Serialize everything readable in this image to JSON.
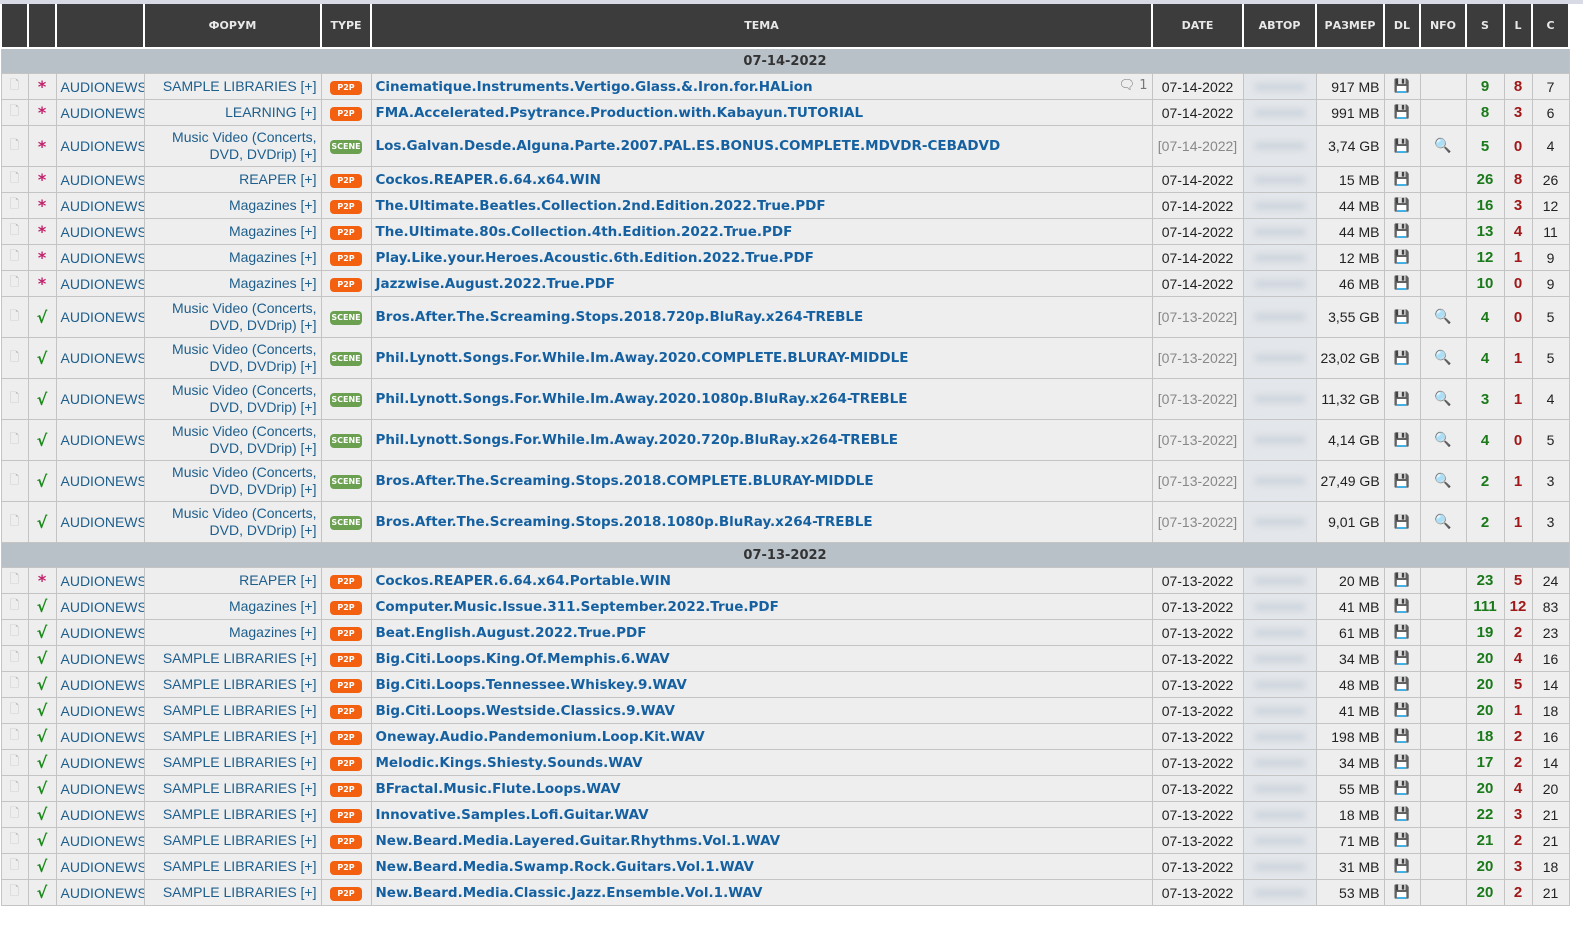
{
  "headers": [
    "",
    "",
    "",
    "ФОРУМ",
    "TYPE",
    "TEMA",
    "DATE",
    "АВТОР",
    "РАЗМЕР",
    "DL",
    "NFO",
    "S",
    "L",
    "C"
  ],
  "groups": [
    {
      "date": "07-14-2022",
      "rows": [
        {
          "st": "*",
          "cat": "AUDIONEWS",
          "forum": "SAMPLE LIBRARIES [+]",
          "type": "P2P",
          "title": "Cinematique.Instruments.Vertigo.Glass.&.Iron.for.HALion",
          "comments": "1",
          "date": "07-14-2022",
          "size": "917 MB",
          "nfo": false,
          "s": "9",
          "l": "8",
          "c": "7"
        },
        {
          "st": "*",
          "cat": "AUDIONEWS",
          "forum": "LEARNING [+]",
          "type": "P2P",
          "title": "FMA.Accelerated.Psytrance.Production.with.Kabayun.TUTORIAL",
          "date": "07-14-2022",
          "size": "991 MB",
          "nfo": false,
          "s": "8",
          "l": "3",
          "c": "6"
        },
        {
          "st": "*",
          "cat": "AUDIONEWS",
          "forum": "Music Video (Concerts, DVD, DVDrip) [+]",
          "type": "SCENE",
          "title": "Los.Galvan.Desde.Alguna.Parte.2007.PAL.ES.BONUS.COMPLETE.MDVDR-CEBADVD",
          "date": "[07-14-2022]",
          "size": "3,74 GB",
          "nfo": true,
          "s": "5",
          "l": "0",
          "c": "4"
        },
        {
          "st": "*",
          "cat": "AUDIONEWS",
          "forum": "REAPER [+]",
          "type": "P2P",
          "title": "Cockos.REAPER.6.64.x64.WIN",
          "date": "07-14-2022",
          "size": "15 MB",
          "nfo": false,
          "s": "26",
          "l": "8",
          "c": "26"
        },
        {
          "st": "*",
          "cat": "AUDIONEWS",
          "forum": "Magazines [+]",
          "type": "P2P",
          "title": "The.Ultimate.Beatles.Collection.2nd.Edition.2022.True.PDF",
          "date": "07-14-2022",
          "size": "44 MB",
          "nfo": false,
          "s": "16",
          "l": "3",
          "c": "12"
        },
        {
          "st": "*",
          "cat": "AUDIONEWS",
          "forum": "Magazines [+]",
          "type": "P2P",
          "title": "The.Ultimate.80s.Collection.4th.Edition.2022.True.PDF",
          "date": "07-14-2022",
          "size": "44 MB",
          "nfo": false,
          "s": "13",
          "l": "4",
          "c": "11"
        },
        {
          "st": "*",
          "cat": "AUDIONEWS",
          "forum": "Magazines [+]",
          "type": "P2P",
          "title": "Play.Like.your.Heroes.Acoustic.6th.Edition.2022.True.PDF",
          "date": "07-14-2022",
          "size": "12 MB",
          "nfo": false,
          "s": "12",
          "l": "1",
          "c": "9"
        },
        {
          "st": "*",
          "cat": "AUDIONEWS",
          "forum": "Magazines [+]",
          "type": "P2P",
          "title": "Jazzwise.August.2022.True.PDF",
          "date": "07-14-2022",
          "size": "46 MB",
          "nfo": false,
          "s": "10",
          "l": "0",
          "c": "9"
        },
        {
          "st": "√",
          "cat": "AUDIONEWS",
          "forum": "Music Video (Concerts, DVD, DVDrip) [+]",
          "type": "SCENE",
          "title": "Bros.After.The.Screaming.Stops.2018.720p.BluRay.x264-TREBLE",
          "date": "[07-13-2022]",
          "size": "3,55 GB",
          "nfo": true,
          "s": "4",
          "l": "0",
          "c": "5"
        },
        {
          "st": "√",
          "cat": "AUDIONEWS",
          "forum": "Music Video (Concerts, DVD, DVDrip) [+]",
          "type": "SCENE",
          "title": "Phil.Lynott.Songs.For.While.Im.Away.2020.COMPLETE.BLURAY-MIDDLE",
          "date": "[07-13-2022]",
          "size": "23,02 GB",
          "nfo": true,
          "s": "4",
          "l": "1",
          "c": "5"
        },
        {
          "st": "√",
          "cat": "AUDIONEWS",
          "forum": "Music Video (Concerts, DVD, DVDrip) [+]",
          "type": "SCENE",
          "title": "Phil.Lynott.Songs.For.While.Im.Away.2020.1080p.BluRay.x264-TREBLE",
          "date": "[07-13-2022]",
          "size": "11,32 GB",
          "nfo": true,
          "s": "3",
          "l": "1",
          "c": "4"
        },
        {
          "st": "√",
          "cat": "AUDIONEWS",
          "forum": "Music Video (Concerts, DVD, DVDrip) [+]",
          "type": "SCENE",
          "title": "Phil.Lynott.Songs.For.While.Im.Away.2020.720p.BluRay.x264-TREBLE",
          "date": "[07-13-2022]",
          "size": "4,14 GB",
          "nfo": true,
          "s": "4",
          "l": "0",
          "c": "5"
        },
        {
          "st": "√",
          "cat": "AUDIONEWS",
          "forum": "Music Video (Concerts, DVD, DVDrip) [+]",
          "type": "SCENE",
          "title": "Bros.After.The.Screaming.Stops.2018.COMPLETE.BLURAY-MIDDLE",
          "date": "[07-13-2022]",
          "size": "27,49 GB",
          "nfo": true,
          "s": "2",
          "l": "1",
          "c": "3"
        },
        {
          "st": "√",
          "cat": "AUDIONEWS",
          "forum": "Music Video (Concerts, DVD, DVDrip) [+]",
          "type": "SCENE",
          "title": "Bros.After.The.Screaming.Stops.2018.1080p.BluRay.x264-TREBLE",
          "date": "[07-13-2022]",
          "size": "9,01 GB",
          "nfo": true,
          "s": "2",
          "l": "1",
          "c": "3"
        }
      ]
    },
    {
      "date": "07-13-2022",
      "rows": [
        {
          "st": "*",
          "cat": "AUDIONEWS",
          "forum": "REAPER [+]",
          "type": "P2P",
          "title": "Cockos.REAPER.6.64.x64.Portable.WIN",
          "date": "07-13-2022",
          "size": "20 MB",
          "nfo": false,
          "s": "23",
          "l": "5",
          "c": "24"
        },
        {
          "st": "√",
          "cat": "AUDIONEWS",
          "forum": "Magazines [+]",
          "type": "P2P",
          "title": "Computer.Music.Issue.311.September.2022.True.PDF",
          "date": "07-13-2022",
          "size": "41 MB",
          "nfo": false,
          "s": "111",
          "l": "12",
          "c": "83"
        },
        {
          "st": "√",
          "cat": "AUDIONEWS",
          "forum": "Magazines [+]",
          "type": "P2P",
          "title": "Beat.English.August.2022.True.PDF",
          "date": "07-13-2022",
          "size": "61 MB",
          "nfo": false,
          "s": "19",
          "l": "2",
          "c": "23"
        },
        {
          "st": "√",
          "cat": "AUDIONEWS",
          "forum": "SAMPLE LIBRARIES [+]",
          "type": "P2P",
          "title": "Big.Citi.Loops.King.Of.Memphis.6.WAV",
          "date": "07-13-2022",
          "size": "34 MB",
          "nfo": false,
          "s": "20",
          "l": "4",
          "c": "16"
        },
        {
          "st": "√",
          "cat": "AUDIONEWS",
          "forum": "SAMPLE LIBRARIES [+]",
          "type": "P2P",
          "title": "Big.Citi.Loops.Tennessee.Whiskey.9.WAV",
          "date": "07-13-2022",
          "size": "48 MB",
          "nfo": false,
          "s": "20",
          "l": "5",
          "c": "14"
        },
        {
          "st": "√",
          "cat": "AUDIONEWS",
          "forum": "SAMPLE LIBRARIES [+]",
          "type": "P2P",
          "title": "Big.Citi.Loops.Westside.Classics.9.WAV",
          "date": "07-13-2022",
          "size": "41 MB",
          "nfo": false,
          "s": "20",
          "l": "1",
          "c": "18"
        },
        {
          "st": "√",
          "cat": "AUDIONEWS",
          "forum": "SAMPLE LIBRARIES [+]",
          "type": "P2P",
          "title": "Oneway.Audio.Pandemonium.Loop.Kit.WAV",
          "date": "07-13-2022",
          "size": "198 MB",
          "nfo": false,
          "s": "18",
          "l": "2",
          "c": "16"
        },
        {
          "st": "√",
          "cat": "AUDIONEWS",
          "forum": "SAMPLE LIBRARIES [+]",
          "type": "P2P",
          "title": "Melodic.Kings.Shiesty.Sounds.WAV",
          "date": "07-13-2022",
          "size": "34 MB",
          "nfo": false,
          "s": "17",
          "l": "2",
          "c": "14"
        },
        {
          "st": "√",
          "cat": "AUDIONEWS",
          "forum": "SAMPLE LIBRARIES [+]",
          "type": "P2P",
          "title": "BFractal.Music.Flute.Loops.WAV",
          "date": "07-13-2022",
          "size": "55 MB",
          "nfo": false,
          "s": "20",
          "l": "4",
          "c": "20"
        },
        {
          "st": "√",
          "cat": "AUDIONEWS",
          "forum": "SAMPLE LIBRARIES [+]",
          "type": "P2P",
          "title": "Innovative.Samples.Lofi.Guitar.WAV",
          "date": "07-13-2022",
          "size": "18 MB",
          "nfo": false,
          "s": "22",
          "l": "3",
          "c": "21"
        },
        {
          "st": "√",
          "cat": "AUDIONEWS",
          "forum": "SAMPLE LIBRARIES [+]",
          "type": "P2P",
          "title": "New.Beard.Media.Layered.Guitar.Rhythms.Vol.1.WAV",
          "date": "07-13-2022",
          "size": "71 MB",
          "nfo": false,
          "s": "21",
          "l": "2",
          "c": "21"
        },
        {
          "st": "√",
          "cat": "AUDIONEWS",
          "forum": "SAMPLE LIBRARIES [+]",
          "type": "P2P",
          "title": "New.Beard.Media.Swamp.Rock.Guitars.Vol.1.WAV",
          "date": "07-13-2022",
          "size": "31 MB",
          "nfo": false,
          "s": "20",
          "l": "3",
          "c": "18"
        },
        {
          "st": "√",
          "cat": "AUDIONEWS",
          "forum": "SAMPLE LIBRARIES [+]",
          "type": "P2P",
          "title": "New.Beard.Media.Classic.Jazz.Ensemble.Vol.1.WAV",
          "date": "07-13-2022",
          "size": "53 MB",
          "nfo": false,
          "s": "20",
          "l": "2",
          "c": "21"
        }
      ]
    }
  ]
}
